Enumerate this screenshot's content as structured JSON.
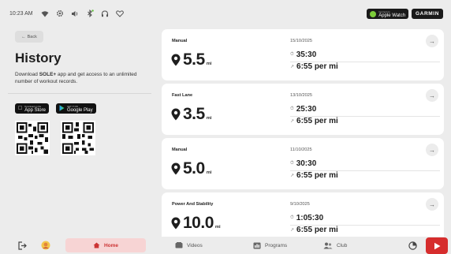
{
  "status_bar": {
    "time": "10:23 AM",
    "icons": [
      "wifi-icon",
      "settings-icon",
      "volume-icon",
      "bluetooth-icon",
      "headphones-icon",
      "heart-rate-icon"
    ],
    "apple_watch_label": "Apple Watch",
    "apple_watch_sub": "Connect to",
    "garmin_label": "GARMIN"
  },
  "history": {
    "back_label": "Back",
    "title": "History",
    "desc_prefix": "Download ",
    "desc_bold": "SOLE+",
    "desc_suffix": " app and get access to an unlimited number of workout records.",
    "app_store_small": "Download on the",
    "app_store_label": "App Store",
    "google_play_small": "GET IT ON",
    "google_play_label": "Google Play"
  },
  "workouts": [
    {
      "name": "Manual",
      "distance": "5.5",
      "unit": "mi",
      "date": "15/10/2025",
      "duration": "35:30",
      "pace": "6:55 per mi"
    },
    {
      "name": "Fast Lane",
      "distance": "3.5",
      "unit": "mi",
      "date": "13/10/2025",
      "duration": "25:30",
      "pace": "6:55 per mi"
    },
    {
      "name": "Manual",
      "distance": "5.0",
      "unit": "mi",
      "date": "11/10/2025",
      "duration": "30:30",
      "pace": "6:55 per mi"
    },
    {
      "name": "Power And Stability",
      "distance": "10.0",
      "unit": "mi",
      "date": "9/10/2025",
      "duration": "1:05:30",
      "pace": "6:55 per mi"
    }
  ],
  "bottom_nav": {
    "home": "Home",
    "videos": "Videos",
    "programs": "Programs",
    "club": "Club"
  },
  "colors": {
    "accent": "#d62d2d",
    "home_highlight": "#f7d4d4",
    "background": "#ececec"
  }
}
